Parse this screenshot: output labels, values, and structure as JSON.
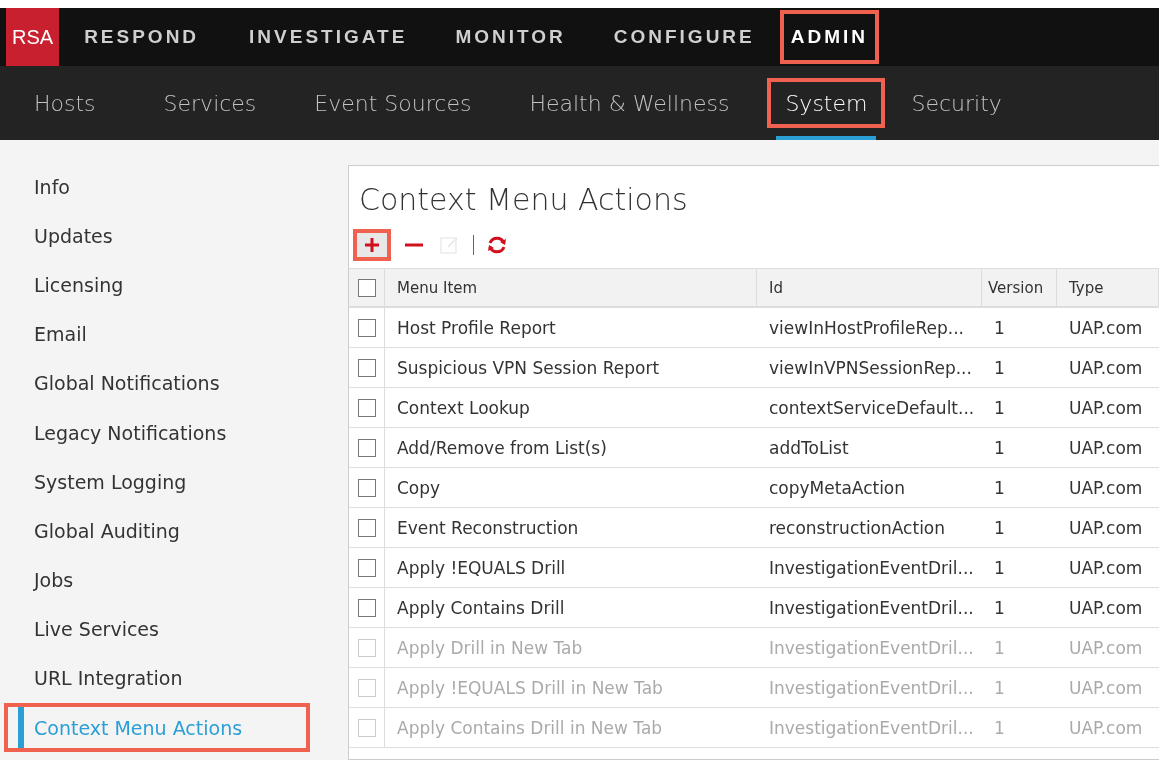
{
  "logo": "RSA",
  "main_nav": [
    {
      "label": "RESPOND",
      "selected": false,
      "highlighted": false
    },
    {
      "label": "INVESTIGATE",
      "selected": false,
      "highlighted": false
    },
    {
      "label": "MONITOR",
      "selected": false,
      "highlighted": false
    },
    {
      "label": "CONFIGURE",
      "selected": false,
      "highlighted": false
    },
    {
      "label": "ADMIN",
      "selected": true,
      "highlighted": true
    }
  ],
  "sub_nav": [
    {
      "label": "Hosts",
      "selected": false,
      "highlighted": false
    },
    {
      "label": "Services",
      "selected": false,
      "highlighted": false
    },
    {
      "label": "Event Sources",
      "selected": false,
      "highlighted": false
    },
    {
      "label": "Health & Wellness",
      "selected": false,
      "highlighted": false
    },
    {
      "label": "System",
      "selected": true,
      "highlighted": true
    },
    {
      "label": "Security",
      "selected": false,
      "highlighted": false
    }
  ],
  "sidebar": {
    "items": [
      {
        "label": "Info",
        "selected": false,
        "highlighted": false
      },
      {
        "label": "Updates",
        "selected": false,
        "highlighted": false
      },
      {
        "label": "Licensing",
        "selected": false,
        "highlighted": false
      },
      {
        "label": "Email",
        "selected": false,
        "highlighted": false
      },
      {
        "label": "Global Notifications",
        "selected": false,
        "highlighted": false
      },
      {
        "label": "Legacy Notifications",
        "selected": false,
        "highlighted": false
      },
      {
        "label": "System Logging",
        "selected": false,
        "highlighted": false
      },
      {
        "label": "Global Auditing",
        "selected": false,
        "highlighted": false
      },
      {
        "label": "Jobs",
        "selected": false,
        "highlighted": false
      },
      {
        "label": "Live Services",
        "selected": false,
        "highlighted": false
      },
      {
        "label": "URL Integration",
        "selected": false,
        "highlighted": false
      },
      {
        "label": "Context Menu Actions",
        "selected": true,
        "highlighted": true
      }
    ]
  },
  "panel": {
    "title": "Context Menu Actions",
    "toolbar": [
      {
        "kind": "add",
        "disabled": false,
        "highlighted": true
      },
      {
        "kind": "remove",
        "disabled": false,
        "highlighted": false
      },
      {
        "kind": "edit",
        "disabled": true,
        "highlighted": false
      },
      {
        "kind": "separator"
      },
      {
        "kind": "refresh",
        "disabled": false,
        "highlighted": false
      }
    ],
    "table": {
      "columns": [
        "Menu Item",
        "Id",
        "Version",
        "Type"
      ],
      "header_checked": false,
      "rows": [
        {
          "cells": [
            "Host Profile Report",
            "viewInHostProfileRep...",
            "1",
            "UAP.com"
          ],
          "checked": false,
          "disabled": false
        },
        {
          "cells": [
            "Suspicious VPN Session Report",
            "viewInVPNSessionRep...",
            "1",
            "UAP.com"
          ],
          "checked": false,
          "disabled": false
        },
        {
          "cells": [
            "Context Lookup",
            "contextServiceDefault...",
            "1",
            "UAP.com"
          ],
          "checked": false,
          "disabled": false
        },
        {
          "cells": [
            "Add/Remove from List(s)",
            "addToList",
            "1",
            "UAP.com"
          ],
          "checked": false,
          "disabled": false
        },
        {
          "cells": [
            "Copy",
            "copyMetaAction",
            "1",
            "UAP.com"
          ],
          "checked": false,
          "disabled": false
        },
        {
          "cells": [
            "Event Reconstruction",
            "reconstructionAction",
            "1",
            "UAP.com"
          ],
          "checked": false,
          "disabled": false
        },
        {
          "cells": [
            "Apply !EQUALS Drill",
            "InvestigationEventDril...",
            "1",
            "UAP.com"
          ],
          "checked": false,
          "disabled": false
        },
        {
          "cells": [
            "Apply Contains Drill",
            "InvestigationEventDril...",
            "1",
            "UAP.com"
          ],
          "checked": false,
          "disabled": false
        },
        {
          "cells": [
            "Apply Drill in New Tab",
            "InvestigationEventDril...",
            "1",
            "UAP.com"
          ],
          "checked": false,
          "disabled": true
        },
        {
          "cells": [
            "Apply !EQUALS Drill in New Tab",
            "InvestigationEventDril...",
            "1",
            "UAP.com"
          ],
          "checked": false,
          "disabled": true
        },
        {
          "cells": [
            "Apply Contains Drill in New Tab",
            "InvestigationEventDril...",
            "1",
            "UAP.com"
          ],
          "checked": false,
          "disabled": true
        }
      ]
    }
  }
}
